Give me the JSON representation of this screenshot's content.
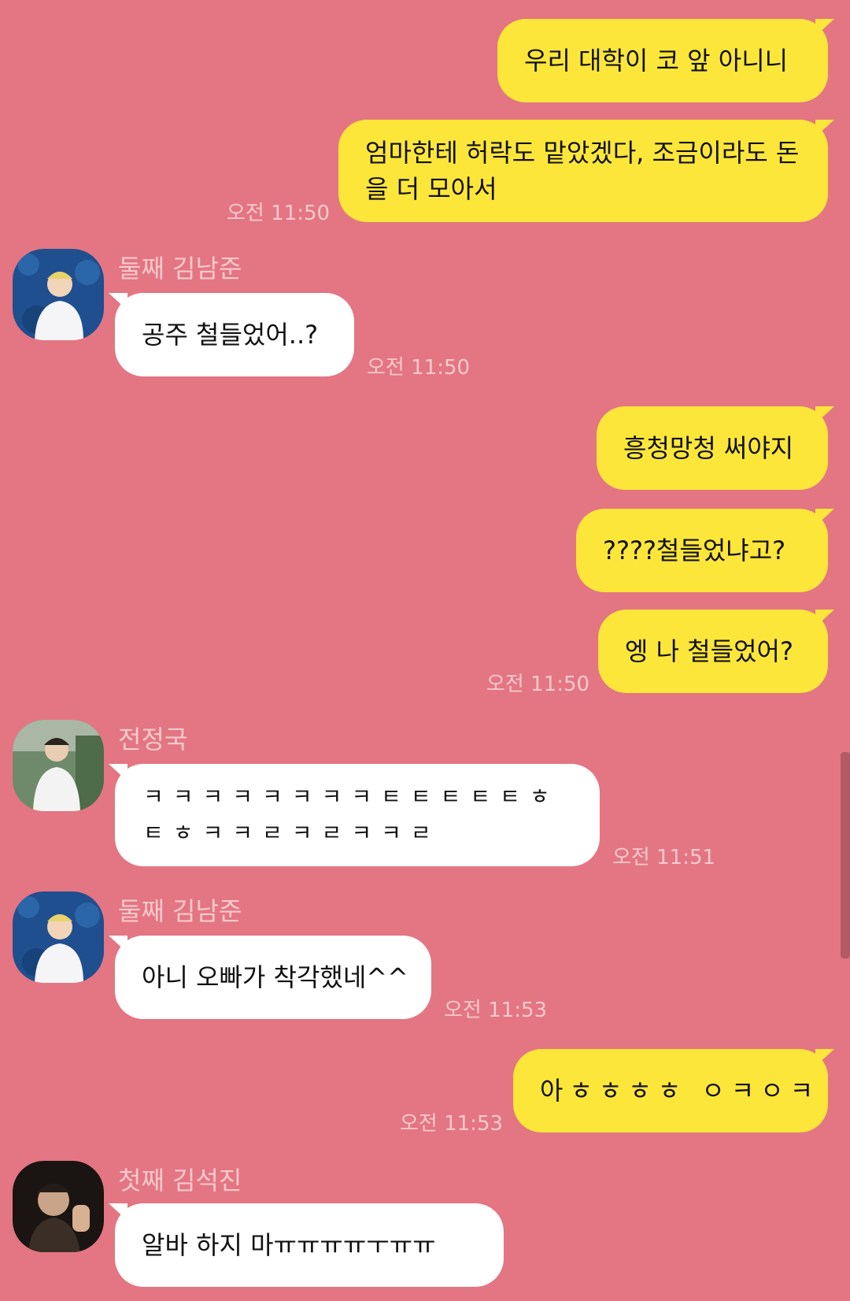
{
  "messages": [
    {
      "id": "m1",
      "text": "우리 대학이 코 앞 아니니"
    },
    {
      "id": "m2",
      "text": "엄마한테 허락도 맡았겠다, 조금이라도 돈을 더 모아서",
      "time": "오전 11:50"
    },
    {
      "id": "m3",
      "sender": "둘째 김남준",
      "text": "공주 철들었어..?",
      "time": "오전 11:50"
    },
    {
      "id": "m4",
      "text": "흥청망청 써야지"
    },
    {
      "id": "m5",
      "text": "????철들었냐고?"
    },
    {
      "id": "m6",
      "text": "엥 나 철들었어?",
      "time": "오전 11:50"
    },
    {
      "id": "m7",
      "sender": "전정국",
      "text": "ㅋㅋㅋㅋㅋㅋㅋㅋㅌㅌㅌㅌㅌㅎㅌㅎㅋㅋㄹㅋㄹㅋㅋㄹ",
      "time": "오전 11:51"
    },
    {
      "id": "m8",
      "sender": "둘째 김남준",
      "text": "아니 오빠가 착각했네^^",
      "time": "오전 11:53"
    },
    {
      "id": "m9",
      "text": "아ㅎㅎㅎㅎ ㅇㅋㅇㅋ",
      "time": "오전 11:53"
    },
    {
      "id": "m10",
      "sender": "첫째 김석진",
      "text": "알바 하지 마ㅠㅠㅠㅠㅜㅠㅠ"
    }
  ],
  "colors": {
    "background": "#e37682",
    "my_bubble": "#fde63a",
    "their_bubble": "#ffffff",
    "meta_text": "#f8c9cc"
  },
  "icons": {
    "avatar_namjoon": "avatar-photo",
    "avatar_jungkook": "avatar-photo",
    "avatar_seokjin": "avatar-photo"
  }
}
